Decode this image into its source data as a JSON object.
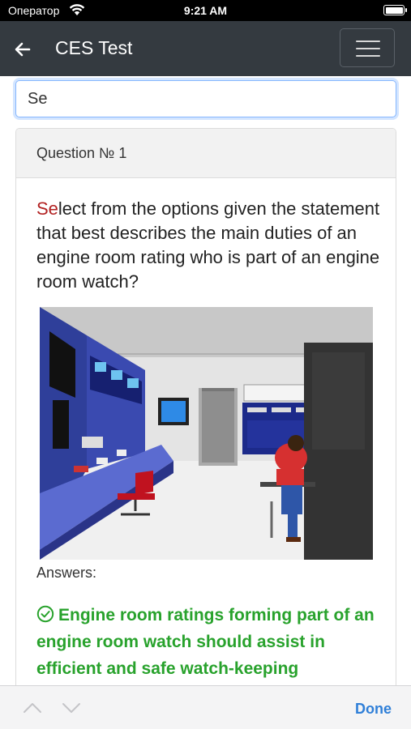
{
  "status_bar": {
    "carrier": "Оператор",
    "time": "9:21 AM",
    "battery_level": 1.0
  },
  "navbar": {
    "title": "CES Test"
  },
  "search": {
    "value": "Se"
  },
  "question": {
    "header": "Question № 1",
    "text_highlight": "Se",
    "text_rest": "lect from the options given the statement that best describes the main duties of an engine room rating who is part of an engine room watch?"
  },
  "answers_label": "Answers:",
  "answers": [
    {
      "text": "Engine room ratings forming part of an engine room watch should assist in efficient and safe watch-keeping",
      "correct": true
    }
  ],
  "toolbar": {
    "done_label": "Done"
  },
  "colors": {
    "navbar": "#343a40",
    "highlight": "#b22222",
    "correct_answer": "#28a22c",
    "done": "#2f7fd8"
  },
  "icons": [
    "wifi-icon",
    "battery-icon",
    "back-arrow-icon",
    "hamburger-menu-icon",
    "check-circle-icon",
    "chevron-up-icon",
    "chevron-down-icon"
  ]
}
